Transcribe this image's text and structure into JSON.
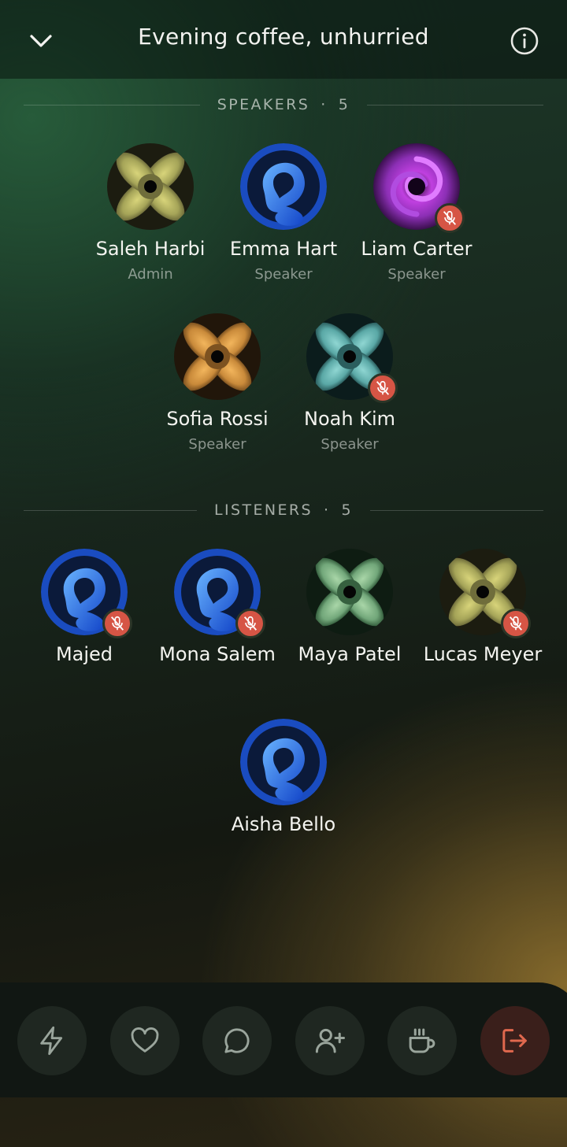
{
  "header": {
    "title": "Evening coffee, unhurried"
  },
  "speakers_section": {
    "label": "SPEAKERS",
    "separator": "·",
    "count": "5"
  },
  "listeners_section": {
    "label": "LISTENERS",
    "separator": "·",
    "count": "5"
  },
  "speakers": [
    {
      "name": "Saleh Harbi",
      "role": "Admin",
      "avatar": "flower-olive",
      "muted": false
    },
    {
      "name": "Emma Hart",
      "role": "Speaker",
      "avatar": "swirl-blue",
      "muted": false
    },
    {
      "name": "Liam Carter",
      "role": "Speaker",
      "avatar": "vortex-purple",
      "muted": true
    },
    {
      "name": "Sofia Rossi",
      "role": "Speaker",
      "avatar": "flower-amber",
      "muted": false
    },
    {
      "name": "Noah Kim",
      "role": "Speaker",
      "avatar": "flower-teal",
      "muted": true
    }
  ],
  "listeners": [
    {
      "name": "Majed",
      "avatar": "swirl-blue",
      "muted": true
    },
    {
      "name": "Mona Salem",
      "avatar": "swirl-blue",
      "muted": true
    },
    {
      "name": "Maya Patel",
      "avatar": "flower-sage",
      "muted": false
    },
    {
      "name": "Lucas Meyer",
      "avatar": "flower-olive",
      "muted": true
    },
    {
      "name": "Aisha Bello",
      "avatar": "swirl-blue",
      "muted": false
    }
  ],
  "actions": [
    {
      "icon": "lightning-icon"
    },
    {
      "icon": "heart-icon"
    },
    {
      "icon": "chat-bubble-icon"
    },
    {
      "icon": "add-user-icon"
    },
    {
      "icon": "coffee-cup-icon"
    },
    {
      "icon": "leave-room-icon"
    }
  ],
  "colors": {
    "mute_badge": "#d65545",
    "leave_icon": "#e0684e",
    "icon_gray": "#9aa59c"
  }
}
